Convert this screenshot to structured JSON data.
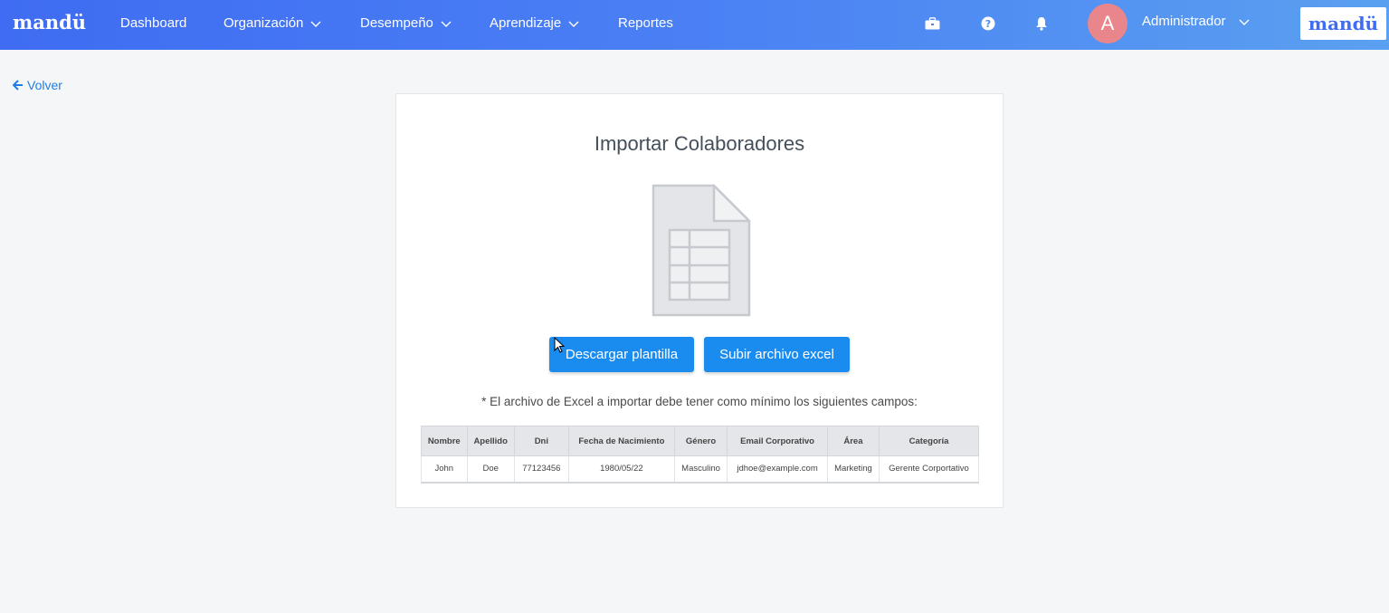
{
  "nav": {
    "brand": "mandü",
    "items": [
      {
        "label": "Dashboard",
        "has_dropdown": false
      },
      {
        "label": "Organización",
        "has_dropdown": true
      },
      {
        "label": "Desempeño",
        "has_dropdown": true
      },
      {
        "label": "Aprendizaje",
        "has_dropdown": true
      },
      {
        "label": "Reportes",
        "has_dropdown": false
      }
    ],
    "icons": [
      "briefcase-icon",
      "help-icon",
      "bell-icon"
    ],
    "avatar_letter": "A",
    "user_name": "Administrador",
    "logo": "mandü"
  },
  "back_link": "Volver",
  "card": {
    "title": "Importar Colaboradores",
    "download_button": "Descargar plantilla",
    "upload_button": "Subir archivo excel",
    "note": "* El archivo de Excel a importar debe tener como mínimo los siguientes campos:",
    "table": {
      "headers": [
        "Nombre",
        "Apellido",
        "Dni",
        "Fecha de Nacimiento",
        "Género",
        "Email Corporativo",
        "Área",
        "Categoría"
      ],
      "rows": [
        [
          "John",
          "Doe",
          "77123456",
          "1980/05/22",
          "Masculino",
          "jdhoe@example.com",
          "Marketing",
          "Gerente Corportativo"
        ]
      ]
    }
  },
  "colors": {
    "nav_gradient_start": "#3f6cf2",
    "nav_gradient_end": "#5aa0f0",
    "primary_button": "#1a8cf0",
    "link": "#1e7ee8",
    "avatar": "#e8868c"
  }
}
